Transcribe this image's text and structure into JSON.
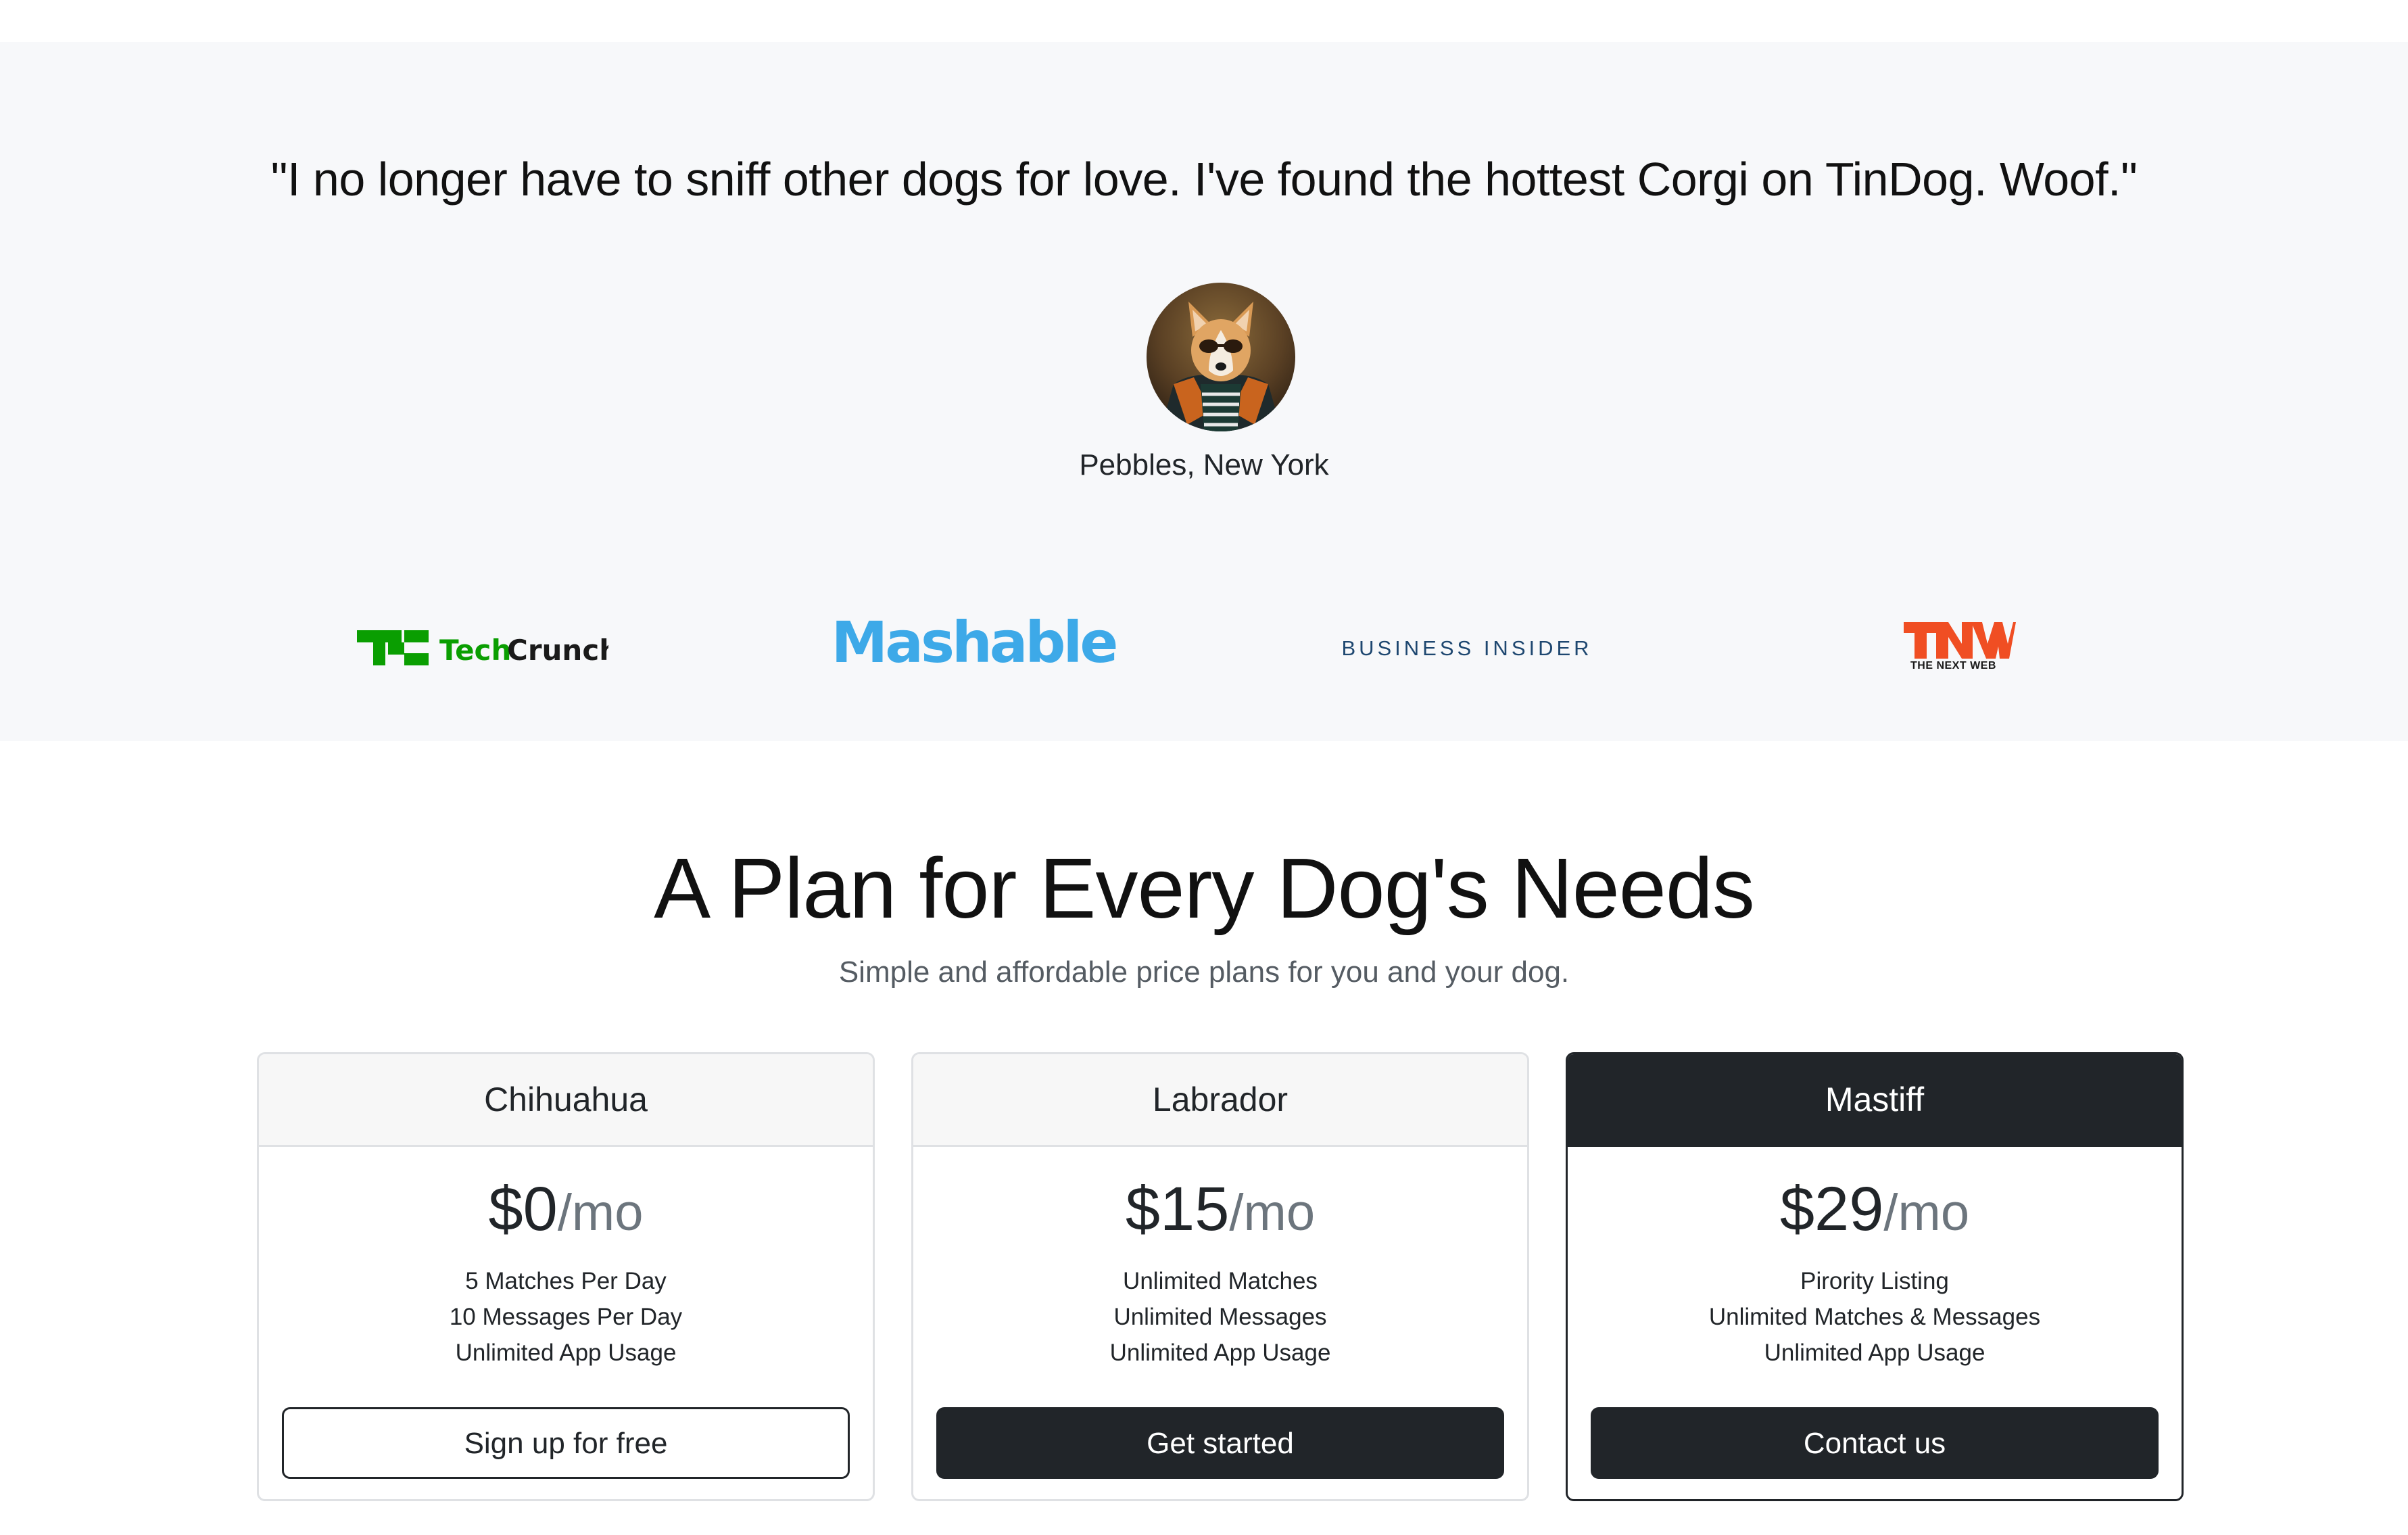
{
  "testimonial": {
    "quote": "\"I no longer have to sniff other dogs for love. I've found the hottest Corgi on TinDog. Woof.\"",
    "author": "Pebbles, New York"
  },
  "press": {
    "techcrunch": "TechCrunch",
    "mashable": "Mashable",
    "business_insider": "BUSINESS INSIDER",
    "tnw": "TNW",
    "tnw_sub": "THE NEXT WEB"
  },
  "pricing": {
    "title": "A Plan for Every Dog's Needs",
    "subtitle": "Simple and affordable price plans for you and your dog.",
    "plans": [
      {
        "name": "Chihuahua",
        "amount": "$0",
        "per": "/mo",
        "features": [
          "5 Matches Per Day",
          "10 Messages Per Day",
          "Unlimited App Usage"
        ],
        "button": "Sign up for free"
      },
      {
        "name": "Labrador",
        "amount": "$15",
        "per": "/mo",
        "features": [
          "Unlimited Matches",
          "Unlimited Messages",
          "Unlimited App Usage"
        ],
        "button": "Get started"
      },
      {
        "name": "Mastiff",
        "amount": "$29",
        "per": "/mo",
        "features": [
          "Pirority Listing",
          "Unlimited Matches & Messages",
          "Unlimited App Usage"
        ],
        "button": "Contact us"
      }
    ]
  },
  "colors": {
    "section_bg": "#f7f8fa",
    "dark": "#212529",
    "techcrunch_green": "#0a9e01",
    "mashable_blue": "#3da9e8",
    "business_insider_navy": "#1e4770",
    "tnw_orange": "#f04e23"
  }
}
